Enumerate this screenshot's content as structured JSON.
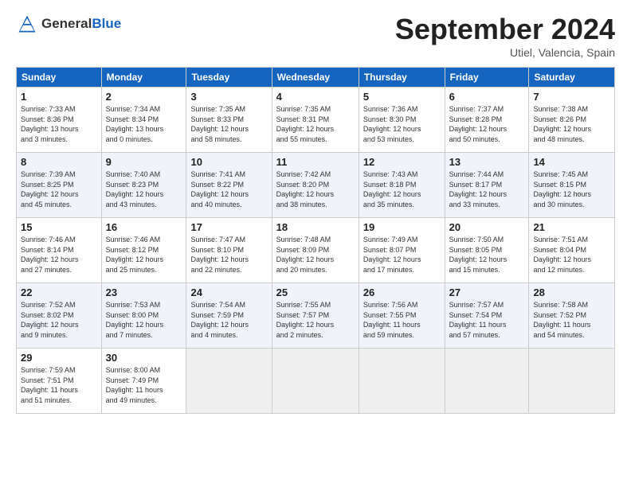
{
  "header": {
    "logo_general": "General",
    "logo_blue": "Blue",
    "month_title": "September 2024",
    "location": "Utiel, Valencia, Spain"
  },
  "days_of_week": [
    "Sunday",
    "Monday",
    "Tuesday",
    "Wednesday",
    "Thursday",
    "Friday",
    "Saturday"
  ],
  "weeks": [
    [
      {
        "day": "1",
        "info": "Sunrise: 7:33 AM\nSunset: 8:36 PM\nDaylight: 13 hours\nand 3 minutes."
      },
      {
        "day": "2",
        "info": "Sunrise: 7:34 AM\nSunset: 8:34 PM\nDaylight: 13 hours\nand 0 minutes."
      },
      {
        "day": "3",
        "info": "Sunrise: 7:35 AM\nSunset: 8:33 PM\nDaylight: 12 hours\nand 58 minutes."
      },
      {
        "day": "4",
        "info": "Sunrise: 7:35 AM\nSunset: 8:31 PM\nDaylight: 12 hours\nand 55 minutes."
      },
      {
        "day": "5",
        "info": "Sunrise: 7:36 AM\nSunset: 8:30 PM\nDaylight: 12 hours\nand 53 minutes."
      },
      {
        "day": "6",
        "info": "Sunrise: 7:37 AM\nSunset: 8:28 PM\nDaylight: 12 hours\nand 50 minutes."
      },
      {
        "day": "7",
        "info": "Sunrise: 7:38 AM\nSunset: 8:26 PM\nDaylight: 12 hours\nand 48 minutes."
      }
    ],
    [
      {
        "day": "8",
        "info": "Sunrise: 7:39 AM\nSunset: 8:25 PM\nDaylight: 12 hours\nand 45 minutes."
      },
      {
        "day": "9",
        "info": "Sunrise: 7:40 AM\nSunset: 8:23 PM\nDaylight: 12 hours\nand 43 minutes."
      },
      {
        "day": "10",
        "info": "Sunrise: 7:41 AM\nSunset: 8:22 PM\nDaylight: 12 hours\nand 40 minutes."
      },
      {
        "day": "11",
        "info": "Sunrise: 7:42 AM\nSunset: 8:20 PM\nDaylight: 12 hours\nand 38 minutes."
      },
      {
        "day": "12",
        "info": "Sunrise: 7:43 AM\nSunset: 8:18 PM\nDaylight: 12 hours\nand 35 minutes."
      },
      {
        "day": "13",
        "info": "Sunrise: 7:44 AM\nSunset: 8:17 PM\nDaylight: 12 hours\nand 33 minutes."
      },
      {
        "day": "14",
        "info": "Sunrise: 7:45 AM\nSunset: 8:15 PM\nDaylight: 12 hours\nand 30 minutes."
      }
    ],
    [
      {
        "day": "15",
        "info": "Sunrise: 7:46 AM\nSunset: 8:14 PM\nDaylight: 12 hours\nand 27 minutes."
      },
      {
        "day": "16",
        "info": "Sunrise: 7:46 AM\nSunset: 8:12 PM\nDaylight: 12 hours\nand 25 minutes."
      },
      {
        "day": "17",
        "info": "Sunrise: 7:47 AM\nSunset: 8:10 PM\nDaylight: 12 hours\nand 22 minutes."
      },
      {
        "day": "18",
        "info": "Sunrise: 7:48 AM\nSunset: 8:09 PM\nDaylight: 12 hours\nand 20 minutes."
      },
      {
        "day": "19",
        "info": "Sunrise: 7:49 AM\nSunset: 8:07 PM\nDaylight: 12 hours\nand 17 minutes."
      },
      {
        "day": "20",
        "info": "Sunrise: 7:50 AM\nSunset: 8:05 PM\nDaylight: 12 hours\nand 15 minutes."
      },
      {
        "day": "21",
        "info": "Sunrise: 7:51 AM\nSunset: 8:04 PM\nDaylight: 12 hours\nand 12 minutes."
      }
    ],
    [
      {
        "day": "22",
        "info": "Sunrise: 7:52 AM\nSunset: 8:02 PM\nDaylight: 12 hours\nand 9 minutes."
      },
      {
        "day": "23",
        "info": "Sunrise: 7:53 AM\nSunset: 8:00 PM\nDaylight: 12 hours\nand 7 minutes."
      },
      {
        "day": "24",
        "info": "Sunrise: 7:54 AM\nSunset: 7:59 PM\nDaylight: 12 hours\nand 4 minutes."
      },
      {
        "day": "25",
        "info": "Sunrise: 7:55 AM\nSunset: 7:57 PM\nDaylight: 12 hours\nand 2 minutes."
      },
      {
        "day": "26",
        "info": "Sunrise: 7:56 AM\nSunset: 7:55 PM\nDaylight: 11 hours\nand 59 minutes."
      },
      {
        "day": "27",
        "info": "Sunrise: 7:57 AM\nSunset: 7:54 PM\nDaylight: 11 hours\nand 57 minutes."
      },
      {
        "day": "28",
        "info": "Sunrise: 7:58 AM\nSunset: 7:52 PM\nDaylight: 11 hours\nand 54 minutes."
      }
    ],
    [
      {
        "day": "29",
        "info": "Sunrise: 7:59 AM\nSunset: 7:51 PM\nDaylight: 11 hours\nand 51 minutes."
      },
      {
        "day": "30",
        "info": "Sunrise: 8:00 AM\nSunset: 7:49 PM\nDaylight: 11 hours\nand 49 minutes."
      },
      null,
      null,
      null,
      null,
      null
    ]
  ]
}
